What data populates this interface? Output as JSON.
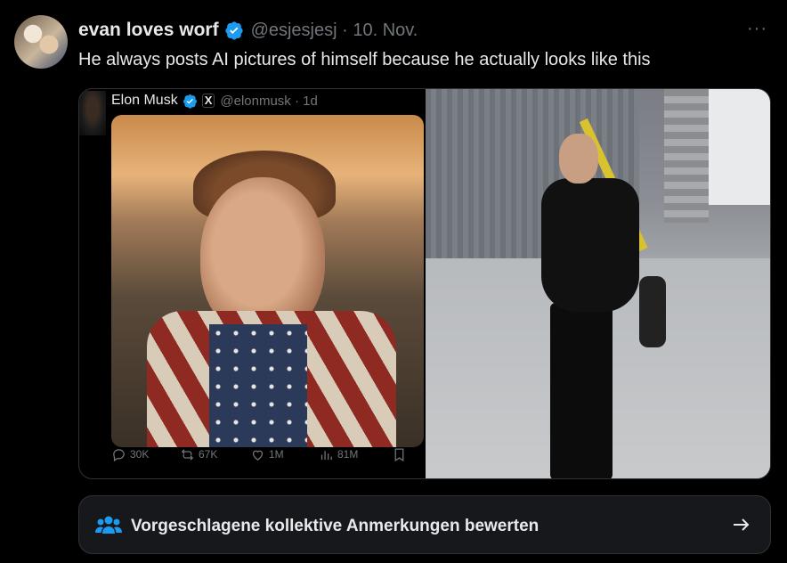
{
  "tweet": {
    "display_name": "evan loves worf",
    "handle_time": "@esjesjesj · 10. Nov.",
    "text": "He always posts AI pictures of himself because he actually looks like this",
    "more_label": "···"
  },
  "quote": {
    "name": "Elon Musk",
    "x_badge": "X",
    "handle_time": "@elonmusk · 1d",
    "actions": {
      "replies": "30K",
      "reposts": "67K",
      "likes": "1M",
      "views": "81M"
    }
  },
  "cta": {
    "label": "Vorgeschlagene kollektive Anmerkungen bewerten"
  },
  "colors": {
    "background": "#000000",
    "text": "#e7e9ea",
    "muted": "#71767b",
    "verified_blue": "#1d9bf0",
    "border": "#2f3336"
  },
  "icons": [
    "verified-badge-icon",
    "more-icon",
    "reply-icon",
    "repost-icon",
    "like-icon",
    "views-icon",
    "bookmark-icon",
    "community-notes-icon",
    "arrow-right-icon"
  ]
}
